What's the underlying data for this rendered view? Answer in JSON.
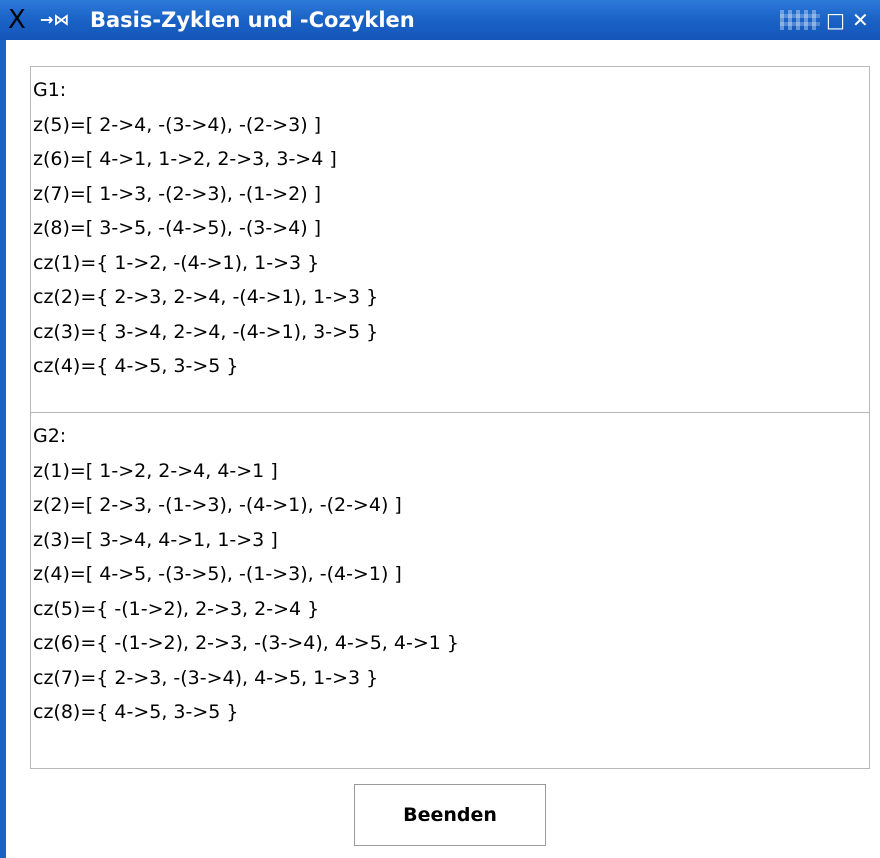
{
  "window": {
    "title": "Basis-Zyklen und -Cozyklen",
    "app_icon": "x-window-icon",
    "pin_icon": "pin-icon",
    "accent_color": "#1a62c6"
  },
  "panels": {
    "g1": {
      "lines": [
        "G1:",
        "z(5)=[ 2->4, -(3->4), -(2->3) ]",
        "z(6)=[ 4->1, 1->2, 2->3, 3->4 ]",
        "z(7)=[ 1->3, -(2->3), -(1->2) ]",
        "z(8)=[ 3->5, -(4->5), -(3->4) ]",
        "cz(1)={ 1->2, -(4->1), 1->3 }",
        "cz(2)={ 2->3, 2->4, -(4->1), 1->3 }",
        "cz(3)={ 3->4, 2->4, -(4->1), 3->5 }",
        "cz(4)={ 4->5, 3->5 }"
      ]
    },
    "g2": {
      "lines": [
        "G2:",
        "z(1)=[ 1->2, 2->4, 4->1 ]",
        "z(2)=[ 2->3, -(1->3), -(4->1), -(2->4) ]",
        "z(3)=[ 3->4, 4->1, 1->3 ]",
        "z(4)=[ 4->5, -(3->5), -(1->3), -(4->1) ]",
        "cz(5)={ -(1->2), 2->3, 2->4 }",
        "cz(6)={ -(1->2), 2->3, -(3->4), 4->5, 4->1 }",
        "cz(7)={ 2->3, -(3->4), 4->5, 1->3 }",
        "cz(8)={ 4->5, 3->5 }"
      ]
    }
  },
  "buttons": {
    "quit_label": "Beenden"
  }
}
